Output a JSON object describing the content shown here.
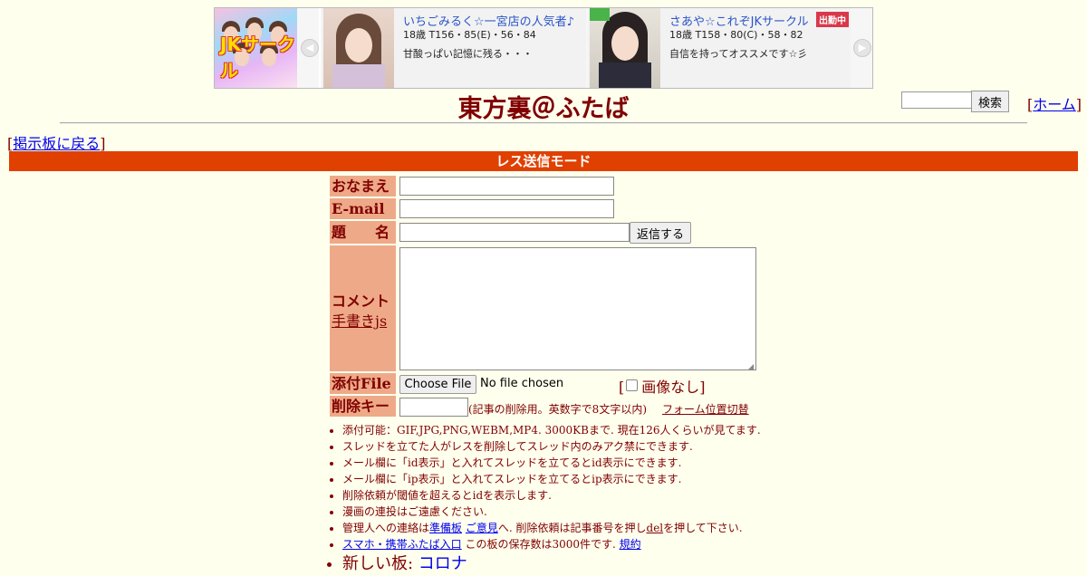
{
  "banner": {
    "logo_text": "JKサークル",
    "cards": [
      {
        "name": "いちごみるく☆一宮店の人気者♪",
        "stats": "18歳 T156・85(E)・56・84",
        "desc": "甘酸っぱい記憶に残る・・・"
      },
      {
        "name": "さあや☆これぞJKサークル",
        "stats": "18歳 T158・80(C)・58・82",
        "desc": "自信を持ってオススメです☆彡",
        "badge": "出勤中"
      }
    ]
  },
  "header": {
    "title": "東方裏＠ふたば",
    "search_button": "検索",
    "home_link": "ホーム"
  },
  "nav": {
    "back_link": "掲示板に戻る"
  },
  "mode_bar": "レス送信モード",
  "form": {
    "name_label": "おなまえ",
    "email_label": "E-mail",
    "subject_label": "題　　名",
    "submit_label": "返信する",
    "comment_label": "コメント",
    "handwriting_link": "手書きjs",
    "file_label": "添付File",
    "choose_file_label": "Choose File",
    "no_file_text": "No file chosen",
    "no_image_label": "画像なし",
    "delkey_label": "削除キー",
    "delkey_note": "(記事の削除用。英数字で8文字以内)",
    "form_position_link": "フォーム位置切替"
  },
  "rules": {
    "r1": "添付可能：GIF,JPG,PNG,WEBM,MP4. 3000KBまで. 現在126人くらいが見てます.",
    "r2": "スレッドを立てた人がレスを削除してスレッド内のみアク禁にできます.",
    "r3": "メール欄に「id表示」と入れてスレッドを立てるとid表示にできます.",
    "r4": "メール欄に「ip表示」と入れてスレッドを立てるとip表示にできます.",
    "r5": "削除依頼が閾値を超えるとidを表示します.",
    "r6": "漫画の連投はご遠慮ください.",
    "r7": {
      "pre": "管理人への連絡は",
      "link1": "準備板",
      "link2": "ご意見",
      "mid": "へ. 削除依頼は記事番号を押し",
      "del": "del",
      "post": "を押して下さい."
    },
    "r8": {
      "link1": "スマホ・携帯ふたば入口",
      "mid": " この板の保存数は3000件です. ",
      "link2": "規約"
    },
    "r9": {
      "pre": "新しい板: ",
      "link": "コロナ"
    }
  }
}
